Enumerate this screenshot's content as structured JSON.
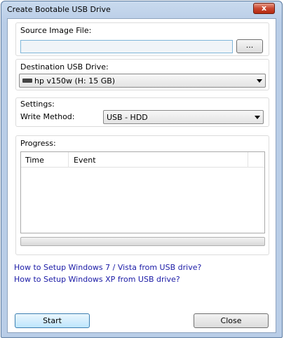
{
  "window": {
    "title": "Create Bootable USB Drive",
    "close_glyph": "x"
  },
  "source": {
    "label": "Source Image File:",
    "value": "",
    "browse_label": "..."
  },
  "destination": {
    "label": "Destination USB Drive:",
    "selected": "hp v150w (H: 15 GB)",
    "icon": "drive-icon"
  },
  "settings": {
    "label": "Settings:",
    "write_method_label": "Write Method:",
    "write_method_selected": "USB - HDD"
  },
  "progress": {
    "label": "Progress:",
    "columns": [
      "Time",
      "Event"
    ],
    "value_fraction": 0
  },
  "links": [
    "How to Setup Windows 7 / Vista from USB drive?",
    "How to Setup Windows XP from USB drive?"
  ],
  "buttons": {
    "start": "Start",
    "close": "Close"
  }
}
